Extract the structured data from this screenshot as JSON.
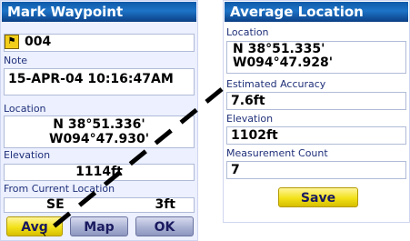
{
  "mark_waypoint": {
    "title": "Mark Waypoint",
    "waypoint_name": "004",
    "icon": "waypoint-flag-icon",
    "note_label": "Note",
    "note_value": "15-APR-04 10:16:47AM",
    "location_label": "Location",
    "location_lat": "N  38°51.336'",
    "location_lon": "W094°47.930'",
    "elevation_label": "Elevation",
    "elevation_value": "1114ft",
    "from_current_label": "From Current Location",
    "bearing": "SE",
    "distance": "3ft",
    "buttons": {
      "avg": "Avg",
      "map": "Map",
      "ok": "OK"
    }
  },
  "average_location": {
    "title": "Average Location",
    "location_label": "Location",
    "location_lat": "N  38°51.335'",
    "location_lon": "W094°47.928'",
    "accuracy_label": "Estimated Accuracy",
    "accuracy_value": "7.6ft",
    "elevation_label": "Elevation",
    "elevation_value": "1102ft",
    "count_label": "Measurement Count",
    "count_value": "7",
    "save_label": "Save"
  },
  "colors": {
    "title_bar": "#1e74c8",
    "selected_button": "#f2e118",
    "screen_bg": "#ecf0ff"
  }
}
